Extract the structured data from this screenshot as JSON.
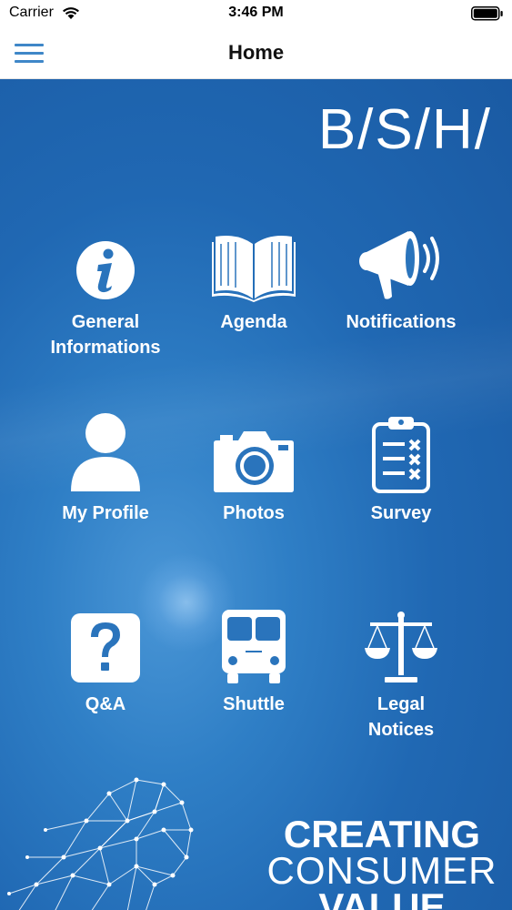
{
  "status_bar": {
    "carrier": "Carrier",
    "time": "3:46 PM"
  },
  "nav": {
    "title": "Home"
  },
  "brand": {
    "logo_text": "B/S/H/"
  },
  "tiles": [
    {
      "label": "General\nInformations",
      "icon": "info-icon"
    },
    {
      "label": "Agenda",
      "icon": "open-book-icon"
    },
    {
      "label": "Notifications",
      "icon": "megaphone-icon"
    },
    {
      "label": "My Profile",
      "icon": "person-icon"
    },
    {
      "label": "Photos",
      "icon": "camera-icon"
    },
    {
      "label": "Survey",
      "icon": "clipboard-checklist-icon"
    },
    {
      "label": "Q&A",
      "icon": "question-icon"
    },
    {
      "label": "Shuttle",
      "icon": "bus-icon"
    },
    {
      "label": "Legal\nNotices",
      "icon": "scales-icon"
    }
  ],
  "tagline": {
    "line1": "CREATING",
    "line2": "CONSUMER",
    "line3": "VALUE"
  },
  "colors": {
    "accent": "#3f87c8",
    "background_blue": "#2068b3",
    "icon_white": "#ffffff"
  }
}
